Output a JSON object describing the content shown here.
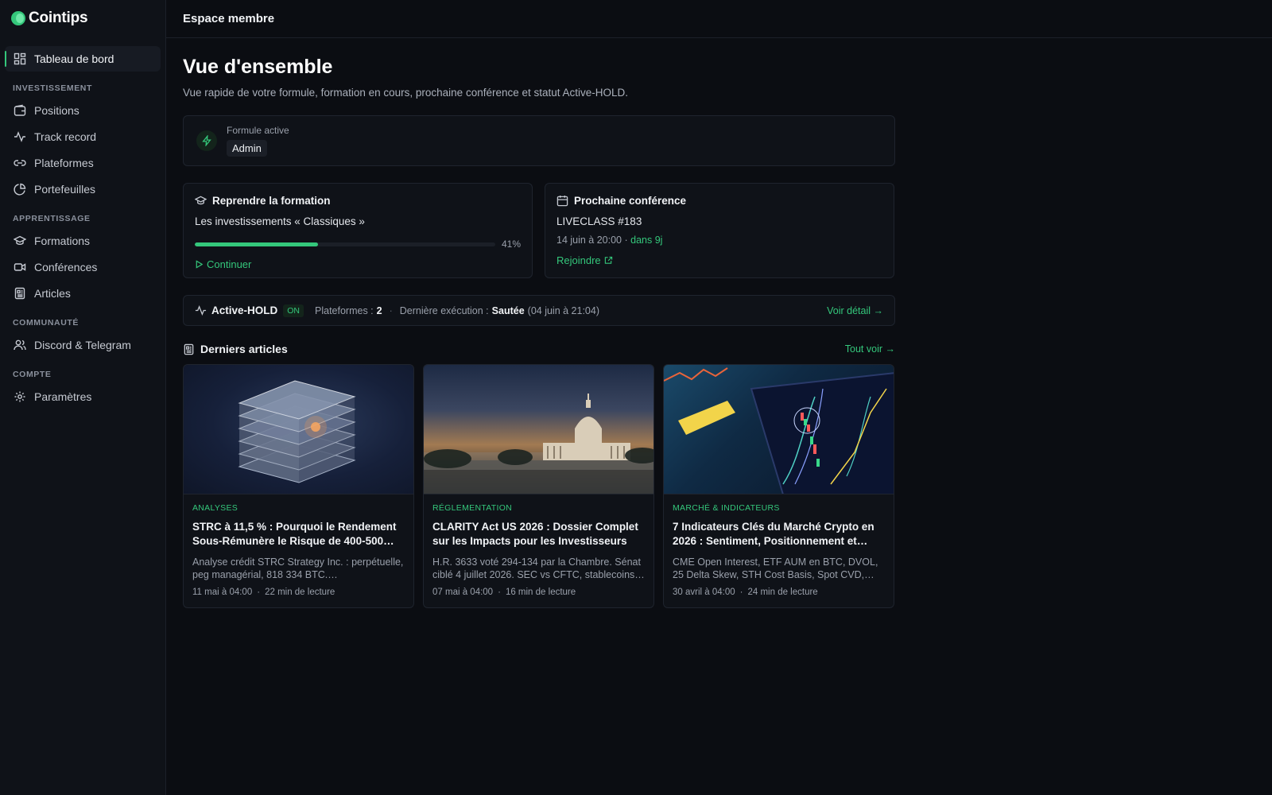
{
  "brand": {
    "name": "Cointips"
  },
  "sidebar": {
    "dashboard": "Tableau de bord",
    "sections": [
      {
        "title": "INVESTISSEMENT",
        "items": [
          "Positions",
          "Track record",
          "Plateformes",
          "Portefeuilles"
        ]
      },
      {
        "title": "APPRENTISSAGE",
        "items": [
          "Formations",
          "Conférences",
          "Articles"
        ]
      },
      {
        "title": "COMMUNAUTÉ",
        "items": [
          "Discord & Telegram"
        ]
      },
      {
        "title": "COMPTE",
        "items": [
          "Paramètres"
        ]
      }
    ]
  },
  "topbar": {
    "title": "Espace membre"
  },
  "page": {
    "title": "Vue d'ensemble",
    "subtitle": "Vue rapide de votre formule, formation en cours, prochaine conférence et statut Active-HOLD."
  },
  "formula": {
    "label": "Formule active",
    "value": "Admin"
  },
  "training": {
    "title": "Reprendre la formation",
    "course": "Les investissements « Classiques »",
    "progress_pct": 41,
    "progress_label": "41%",
    "cta": "Continuer"
  },
  "conference": {
    "title": "Prochaine conférence",
    "name": "LIVECLASS #183",
    "date": "14 juin à 20:00",
    "sep": "·",
    "countdown": "dans 9j",
    "cta": "Rejoindre"
  },
  "active_hold": {
    "title": "Active-HOLD",
    "status": "ON",
    "platforms_label": "Plateformes :",
    "platforms_value": "2",
    "sep": "·",
    "last_label": "Dernière exécution :",
    "last_value": "Sautée",
    "last_date": "(04 juin à 21:04)",
    "detail": "Voir détail →"
  },
  "articles": {
    "title": "Derniers articles",
    "see_all": "Tout voir →",
    "items": [
      {
        "category": "ANALYSES",
        "title": "STRC à 11,5 % : Pourquoi le Rendement Sous-Rémunère le Risque de 400-500…",
        "desc": "Analyse crédit STRC Strategy Inc. : perpétuelle, peg managérial, 818 334 BTC.…",
        "date": "11 mai à 04:00",
        "read": "22 min de lecture"
      },
      {
        "category": "RÉGLEMENTATION",
        "title": "CLARITY Act US 2026 : Dossier Complet sur les Impacts pour les Investisseurs",
        "desc": "H.R. 3633 voté 294-134 par la Chambre. Sénat ciblé 4 juillet 2026. SEC vs CFTC, stablecoins…",
        "date": "07 mai à 04:00",
        "read": "16 min de lecture"
      },
      {
        "category": "MARCHÉ & INDICATEURS",
        "title": "7 Indicateurs Clés du Marché Crypto en 2026 : Sentiment, Positionnement et…",
        "desc": "CME Open Interest, ETF AUM en BTC, DVOL, 25 Delta Skew, STH Cost Basis, Spot CVD,…",
        "date": "30 avril à 04:00",
        "read": "24 min de lecture"
      }
    ]
  },
  "colors": {
    "accent": "#34c77b",
    "bg": "#0b0d12",
    "panel": "#0f1218"
  }
}
